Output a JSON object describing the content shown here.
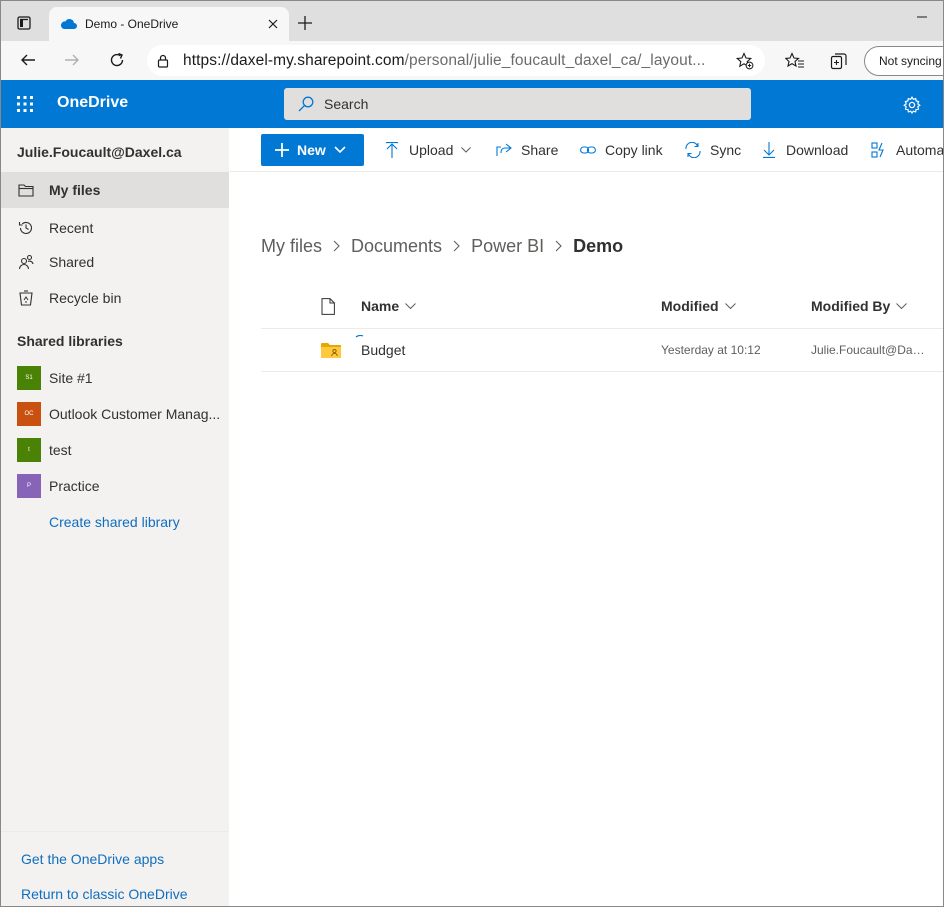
{
  "browser": {
    "tab_title": "Demo - OneDrive",
    "url_host": "https://daxel-my.sharepoint.com",
    "url_path": "/personal/julie_foucault_daxel_ca/_layout...",
    "sync_status": "Not syncing"
  },
  "suite": {
    "app_name": "OneDrive",
    "search_placeholder": "Search"
  },
  "sidebar": {
    "user": "Julie.Foucault@Daxel.ca",
    "items": [
      {
        "label": "My files",
        "icon": "folder-icon",
        "active": true
      },
      {
        "label": "Recent",
        "icon": "history-icon"
      },
      {
        "label": "Shared",
        "icon": "people-icon"
      },
      {
        "label": "Recycle bin",
        "icon": "recycle-bin-icon"
      }
    ],
    "shared_libraries_title": "Shared libraries",
    "libraries": [
      {
        "badge": "S1",
        "label": "Site #1",
        "color": "#498205"
      },
      {
        "badge": "OC",
        "label": "Outlook Customer Manag...",
        "color": "#ca5010"
      },
      {
        "badge": "t",
        "label": "test",
        "color": "#498205"
      },
      {
        "badge": "P",
        "label": "Practice",
        "color": "#8764b8"
      }
    ],
    "create_library": "Create shared library",
    "get_apps": "Get the OneDrive apps",
    "return_classic": "Return to classic OneDrive"
  },
  "commands": {
    "new": "New",
    "upload": "Upload",
    "share": "Share",
    "copy_link": "Copy link",
    "sync": "Sync",
    "download": "Download",
    "automate": "Automate"
  },
  "breadcrumb": [
    "My files",
    "Documents",
    "Power BI",
    "Demo"
  ],
  "list": {
    "columns": {
      "name": "Name",
      "modified": "Modified",
      "modified_by": "Modified By"
    },
    "rows": [
      {
        "name": "Budget",
        "modified": "Yesterday at 10:12",
        "modified_by": "Julie.Foucault@Daxel.ca",
        "type": "shared-folder"
      }
    ]
  },
  "colors": {
    "brand": "#0078d4",
    "nav_bg": "#f3f2f1",
    "link": "#106ebe",
    "folder": "#ffb900"
  }
}
